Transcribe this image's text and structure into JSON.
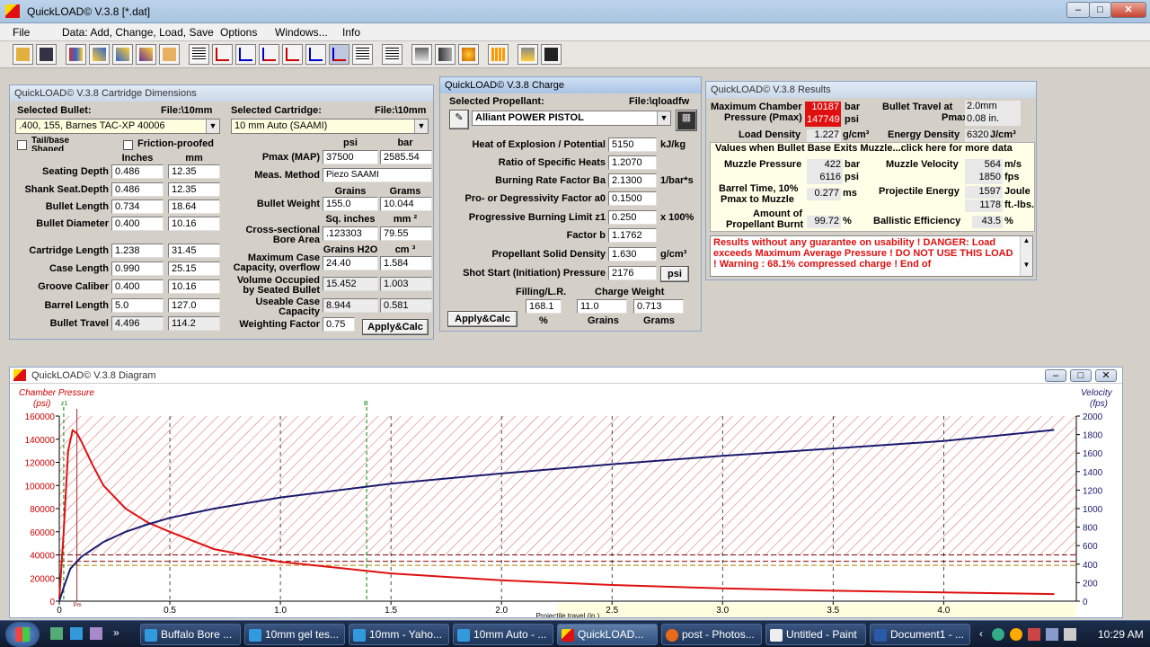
{
  "app": {
    "title": "QuickLOAD© V.3.8   [*.dat]",
    "min": "–",
    "max": "□",
    "close": "✕"
  },
  "menu": [
    "File",
    "Data: Add, Change, Load, Save",
    "Options",
    "Windows...",
    "Info"
  ],
  "dims": {
    "title": "QuickLOAD© V.3.8 Cartridge Dimensions",
    "selected_bullet_label": "Selected Bullet:",
    "bullet_file": "File:\\10mm",
    "bullet": ".400, 155, Barnes TAC-XP 40006",
    "selected_cartridge_label": "Selected Cartridge:",
    "cartridge_file": "File:\\10mm",
    "cartridge": "10 mm Auto (SAAMI)",
    "tail_base": "Tail/base Shaped",
    "friction": "Friction-proofed",
    "inches": "Inches",
    "mm": "mm",
    "psi": "psi",
    "bar": "bar",
    "rows": [
      {
        "label": "Seating Depth",
        "in": "0.486",
        "mm": "12.35"
      },
      {
        "label": "Shank Seat.Depth",
        "in": "0.486",
        "mm": "12.35"
      },
      {
        "label": "Bullet Length",
        "in": "0.734",
        "mm": "18.64"
      },
      {
        "label": "Bullet Diameter",
        "in": "0.400",
        "mm": "10.16"
      },
      {
        "label": "Cartridge Length",
        "in": "1.238",
        "mm": "31.45"
      },
      {
        "label": "Case Length",
        "in": "0.990",
        "mm": "25.15"
      },
      {
        "label": "Groove Caliber",
        "in": "0.400",
        "mm": "10.16"
      },
      {
        "label": "Barrel Length",
        "in": "5.0",
        "mm": "127.0"
      },
      {
        "label": "Bullet Travel",
        "in": "4.496",
        "mm": "114.2"
      }
    ],
    "pmax_label": "Pmax (MAP)",
    "pmax_psi": "37500",
    "pmax_bar": "2585.54",
    "meas_label": "Meas. Method",
    "meas": "Piezo SAAMI",
    "grains": "Grains",
    "grams": "Grams",
    "bw_label": "Bullet Weight",
    "bw_gr": "155.0",
    "bw_g": "10.044",
    "sq_in": "Sq. inches",
    "mm2": "mm ²",
    "bore_label1": "Cross-sectional",
    "bore_label2": "Bore Area",
    "bore_in": ".123303",
    "bore_mm": "79.55",
    "gh2o": "Grains H2O",
    "cm3": "cm ³",
    "maxcase_label1": "Maximum Case",
    "maxcase_label2": "Capacity, overflow",
    "maxcase_gr": "24.40",
    "maxcase_cm": "1.584",
    "volocc_label1": "Volume Occupied",
    "volocc_label2": "by Seated Bullet",
    "volocc_gr": "15.452",
    "volocc_cm": "1.003",
    "usable_label1": "Useable Case",
    "usable_label2": "Capacity",
    "usable_gr": "8.944",
    "usable_cm": "0.581",
    "wf_label": "Weighting Factor",
    "wf": "0.75",
    "apply": "Apply&Calc"
  },
  "charge": {
    "title": "QuickLOAD© V.3.8 Charge",
    "prop_label": "Selected Propellant:",
    "prop_file": "File:\\qloadfw",
    "propellant": "Alliant POWER PISTOL",
    "rows": [
      {
        "label": "Heat of Explosion / Potential",
        "val": "5150",
        "unit": "kJ/kg"
      },
      {
        "label": "Ratio of Specific Heats",
        "val": "1.2070",
        "unit": ""
      },
      {
        "label": "Burning Rate Factor  Ba",
        "val": "2.1300",
        "unit": "1/bar*s"
      },
      {
        "label": "Pro- or Degressivity Factor  a0",
        "val": "0.1500",
        "unit": ""
      },
      {
        "label": "Progressive Burning Limit z1",
        "val": "0.250",
        "unit": "x 100%"
      },
      {
        "label": "Factor  b",
        "val": "1.1762",
        "unit": ""
      },
      {
        "label": "Propellant Solid Density",
        "val": "1.630",
        "unit": "g/cm³"
      },
      {
        "label": "Shot Start (Initiation) Pressure",
        "val": "2176",
        "unit": ""
      }
    ],
    "psi_btn": "psi",
    "filling_label": "Filling/L.R.",
    "charge_label": "Charge Weight",
    "filling": "168.1",
    "charge_gr": "11.0",
    "charge_g": "0.713",
    "pct": "%",
    "grains": "Grains",
    "grams": "Grams",
    "apply": "Apply&Calc"
  },
  "results": {
    "title": "QuickLOAD© V.3.8 Results",
    "maxp_label1": "Maximum Chamber",
    "maxp_label2": "Pressure (Pmax)",
    "maxp_bar": "10187",
    "maxp_psi": "147749",
    "bar": "bar",
    "psi": "psi",
    "travel_label1": "Bullet Travel at",
    "travel_label2": "Pmax",
    "travel_mm": "2.0mm",
    "travel_in": "0.08 in.",
    "ld_label": "Load Density",
    "ld": "1.227",
    "ld_unit": "g/cm³",
    "ed_label": "Energy Density",
    "ed": "6320",
    "ed_unit": "J/cm³",
    "exit_header": "Values when Bullet Base Exits Muzzle...click here for more data",
    "mp_label": "Muzzle Pressure",
    "mp_bar": "422",
    "mp_psi": "6116",
    "mv_label": "Muzzle Velocity",
    "mv_ms": "564",
    "mv_fps": "1850",
    "ms": "m/s",
    "fps": "fps",
    "bt_label1": "Barrel Time, 10%",
    "bt_label2": "Pmax to Muzzle",
    "bt": "0.277",
    "bt_unit": "ms",
    "pe_label": "Projectile Energy",
    "pe_j": "1597",
    "pe_ft": "1178",
    "joule": "Joule",
    "ftlbs": "ft.-lbs.",
    "ab_label1": "Amount of",
    "ab_label2": "Propellant Burnt",
    "ab": "99.72",
    "ab_unit": "%",
    "be_label": "Ballistic Efficiency",
    "be": "43.5",
    "be_unit": "%",
    "warning": "Results without any guarantee on usability !  DANGER: Load exceeds Maximum Average Pressure ! DO NOT USE THIS LOAD !   Warning : 68.1% compressed charge !   End of"
  },
  "diagram": {
    "title": "QuickLOAD© V.3.8 Diagram",
    "ylabel_left": "Chamber Pressure",
    "yunit_left": "(psi)",
    "ylabel_right": "Velocity",
    "yunit_right": "(fps)",
    "xlabel": "Projectile travel (in.)",
    "mark_z1": "z1",
    "mark_b": "B",
    "mark_pm": "Pm",
    "min": "–",
    "max": "□",
    "close": "✕"
  },
  "chart_data": {
    "type": "line",
    "x_ticks": [
      "0",
      "0.5",
      "1.0",
      "1.5",
      "2.0",
      "2.5",
      "3.0",
      "3.5",
      "4.0"
    ],
    "y_left_ticks": [
      "0",
      "20000",
      "40000",
      "60000",
      "80000",
      "100000",
      "120000",
      "140000",
      "160000"
    ],
    "y_right_ticks": [
      "0",
      "200",
      "400",
      "600",
      "800",
      "1000",
      "1200",
      "1400",
      "1600",
      "1800",
      "2000"
    ],
    "xlim": [
      0,
      4.6
    ],
    "ylim_left": [
      0,
      160000
    ],
    "ylim_right": [
      0,
      2000
    ],
    "series": [
      {
        "name": "Chamber Pressure",
        "axis": "left",
        "color": "#e01010",
        "x": [
          0,
          0.02,
          0.04,
          0.06,
          0.08,
          0.1,
          0.15,
          0.2,
          0.3,
          0.4,
          0.5,
          0.7,
          1.0,
          1.5,
          2.0,
          2.5,
          3.0,
          3.5,
          4.0,
          4.5
        ],
        "y": [
          2000,
          60000,
          130000,
          147749,
          145000,
          138000,
          118000,
          100000,
          80000,
          68000,
          60000,
          45000,
          34000,
          24000,
          18000,
          14000,
          11000,
          9000,
          7500,
          6116
        ]
      },
      {
        "name": "Velocity",
        "axis": "right",
        "color": "#1a1a6e",
        "x": [
          0,
          0.02,
          0.05,
          0.1,
          0.15,
          0.2,
          0.3,
          0.4,
          0.5,
          0.7,
          1.0,
          1.5,
          2.0,
          2.5,
          3.0,
          3.5,
          4.0,
          4.5
        ],
        "y": [
          0,
          150,
          350,
          480,
          560,
          640,
          750,
          830,
          900,
          1000,
          1120,
          1270,
          1380,
          1480,
          1570,
          1650,
          1730,
          1850
        ]
      }
    ]
  },
  "taskbar": {
    "items": [
      "Buffalo Bore ...",
      "10mm gel tes...",
      "10mm - Yaho...",
      "10mm Auto - ...",
      "QuickLOAD...",
      "post - Photos...",
      "Untitled - Paint",
      "Document1 - ..."
    ],
    "clock": "10:29 AM"
  }
}
